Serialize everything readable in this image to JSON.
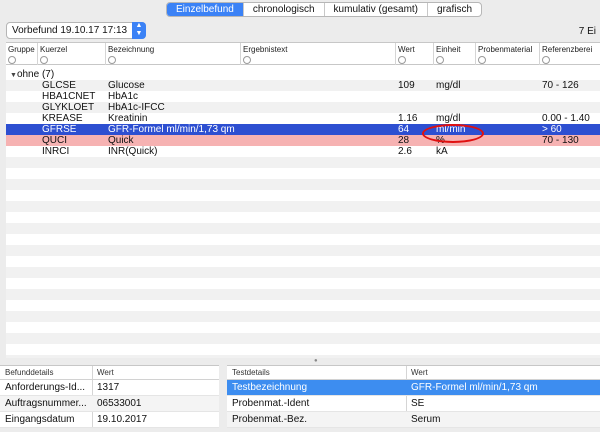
{
  "tabs": [
    {
      "label": "Einzelbefund",
      "active": true
    },
    {
      "label": "chronologisch",
      "active": false
    },
    {
      "label": "kumulativ (gesamt)",
      "active": false
    },
    {
      "label": "grafisch",
      "active": false
    }
  ],
  "dropdown": {
    "value": "Vorbefund 19.10.17 17:13"
  },
  "count_label": "7 Ei",
  "table": {
    "headers": [
      "Gruppe",
      "Kuerzel",
      "Bezeichnung",
      "Ergebnistext",
      "Wert",
      "Einheit",
      "Probenmaterial",
      "Referenzberei"
    ],
    "group_label": "ohne (7)",
    "rows": [
      {
        "kuerzel": "GLCSE",
        "bezeichnung": "Glucose",
        "wert": "109",
        "einheit": "mg/dl",
        "referenz": "70 - 126",
        "state": "normal"
      },
      {
        "kuerzel": "HBA1CNET",
        "bezeichnung": "HbA1c",
        "wert": "",
        "einheit": "",
        "referenz": "",
        "state": "normal"
      },
      {
        "kuerzel": "GLYKLOET",
        "bezeichnung": "HbA1c-IFCC",
        "wert": "",
        "einheit": "",
        "referenz": "",
        "state": "normal"
      },
      {
        "kuerzel": "KREASE",
        "bezeichnung": "Kreatinin",
        "wert": "1.16",
        "einheit": "mg/dl",
        "referenz": "0.00 - 1.40",
        "state": "normal"
      },
      {
        "kuerzel": "GFRSE",
        "bezeichnung": "GFR-Formel ml/min/1,73 qm",
        "wert": "64",
        "einheit": "ml/min",
        "referenz": "> 60",
        "state": "selected"
      },
      {
        "kuerzel": "QUCI",
        "bezeichnung": "Quick",
        "wert": "28",
        "einheit": "%",
        "referenz": "70 - 130",
        "state": "abnormal"
      },
      {
        "kuerzel": "INRCI",
        "bezeichnung": "INR(Quick)",
        "wert": "2.6",
        "einheit": "kA",
        "referenz": "",
        "state": "normal"
      }
    ]
  },
  "befunddetails": {
    "headers": [
      "Befunddetails",
      "Wert"
    ],
    "rows": [
      {
        "label": "Anforderungs-Id...",
        "value": "1317"
      },
      {
        "label": "Auftragsnummer...",
        "value": "06533001"
      },
      {
        "label": "Eingangsdatum",
        "value": "19.10.2017"
      }
    ]
  },
  "testdetails": {
    "headers": [
      "Testdetails",
      "Wert"
    ],
    "rows": [
      {
        "label": "Testbezeichnung",
        "value": "GFR-Formel ml/min/1,73 qm",
        "selected": true
      },
      {
        "label": "Probenmat.-Ident",
        "value": "SE",
        "selected": false
      },
      {
        "label": "Probenmat.-Bez.",
        "value": "Serum",
        "selected": false
      }
    ]
  },
  "colors": {
    "accent": "#3b82f6",
    "selected_row": "#2d4fd1",
    "abnormal_row": "#f6b2b2",
    "highlight_ellipse": "#e01010"
  }
}
